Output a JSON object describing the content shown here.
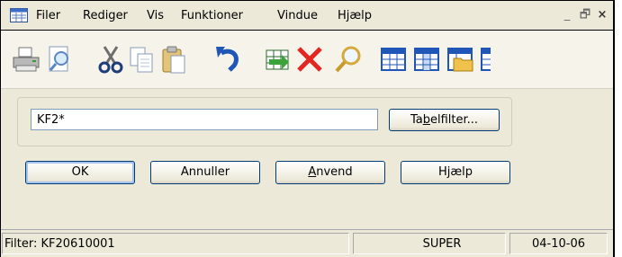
{
  "menu": {
    "items": [
      "Filer",
      "Rediger",
      "Vis",
      "Funktioner",
      "Vindue",
      "Hjælp"
    ],
    "window_controls": [
      "_",
      "🗗",
      "×"
    ]
  },
  "toolbar": {
    "icons": [
      "printer-icon",
      "print-preview-icon",
      "cut-icon",
      "copy-icon",
      "paste-icon",
      "undo-icon",
      "table-arrow-icon",
      "delete-icon",
      "search-icon",
      "table-icon",
      "table-columns-icon",
      "table-folder-icon",
      "table-partial-icon"
    ]
  },
  "dialog": {
    "filter_value": "KF2*",
    "tabelfilter": {
      "pre": "Ta",
      "mn": "b",
      "post": "elfilter..."
    },
    "ok_label": "OK",
    "cancel_label": "Annuller",
    "apply": {
      "pre": "",
      "mn": "A",
      "post": "nvend"
    },
    "help_label": "Hjælp"
  },
  "status": {
    "filter_text": "Filter: KF20610001",
    "user": "SUPER",
    "date": "04-10-06"
  },
  "colors": {
    "window_bg": "#ece9d8",
    "button_border": "#003c74",
    "input_border": "#7f9db9"
  }
}
